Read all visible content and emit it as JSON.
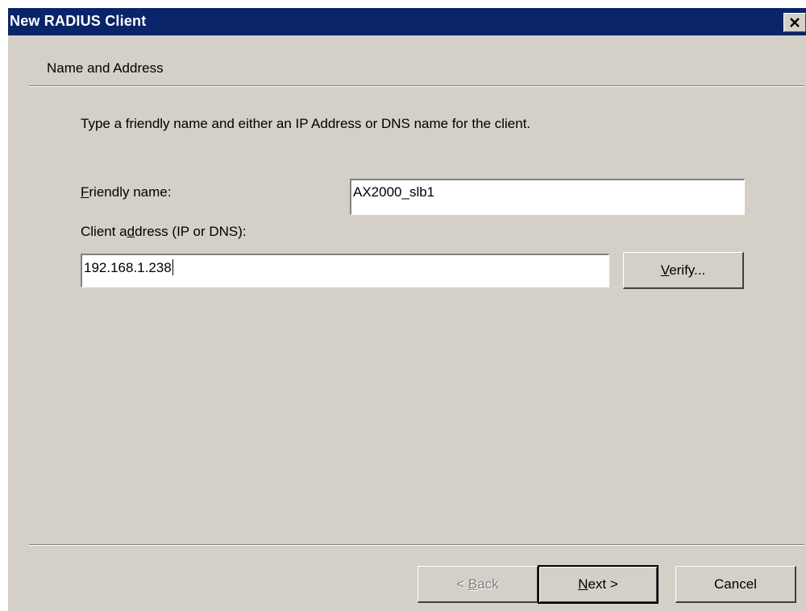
{
  "window": {
    "title": "New RADIUS Client",
    "close_symbol": "×"
  },
  "header": {
    "title": "Name and Address"
  },
  "body": {
    "instruction": "Type a friendly name and either an IP Address or DNS name for the client."
  },
  "form": {
    "friendly_name": {
      "label_hotkey": "F",
      "label_rest": "riendly name:",
      "value": "AX2000_slb1"
    },
    "client_address": {
      "label_before": "Client a",
      "label_hotkey": "d",
      "label_after": "dress (IP or DNS):",
      "value": "192.168.1.238"
    },
    "verify_button": {
      "hotkey": "V",
      "rest": "erify..."
    }
  },
  "footer": {
    "back_button": {
      "prefix": "< ",
      "hotkey": "B",
      "rest": "ack"
    },
    "next_button": {
      "hotkey": "N",
      "rest": "ext >"
    },
    "cancel_button": {
      "label": "Cancel"
    }
  }
}
